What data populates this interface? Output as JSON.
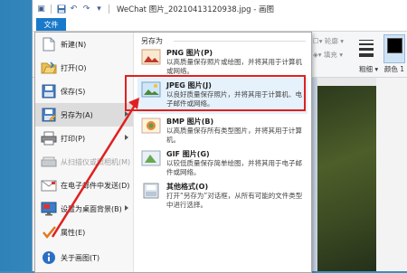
{
  "window": {
    "title": "WeChat 图片_20210413120938.jpg - 画图",
    "file_tab": "文件"
  },
  "ribbon": {
    "outline_label": "轮廓",
    "fill_label": "填充",
    "thickness_label": "粗细",
    "color1_label": "颜色 1"
  },
  "menu": {
    "items": [
      {
        "label": "新建(N)",
        "icon": "new-document-icon"
      },
      {
        "label": "打开(O)",
        "icon": "open-folder-icon"
      },
      {
        "label": "保存(S)",
        "icon": "save-disk-icon"
      },
      {
        "label": "另存为(A)",
        "icon": "save-as-icon"
      },
      {
        "label": "打印(P)",
        "icon": "printer-icon"
      },
      {
        "label": "从扫描仪或照相机(M)",
        "icon": "scanner-icon"
      },
      {
        "label": "在电子邮件中发送(D)",
        "icon": "email-icon"
      },
      {
        "label": "设置为桌面背景(B)",
        "icon": "desktop-background-icon"
      },
      {
        "label": "属性(E)",
        "icon": "properties-check-icon"
      },
      {
        "label": "关于画图(T)",
        "icon": "info-icon"
      }
    ]
  },
  "submenu": {
    "heading": "另存为",
    "items": [
      {
        "title": "PNG 图片(P)",
        "desc": "以高质量保存照片或绘图，并将其用于计算机或网络。",
        "icon": "png-image-icon"
      },
      {
        "title": "JPEG 图片(J)",
        "desc": "以良好质量保存照片，并将其用于计算机、电子邮件或网络。",
        "icon": "jpeg-image-icon"
      },
      {
        "title": "BMP 图片(B)",
        "desc": "以高质量保存所有类型图片，并将其用于计算机。",
        "icon": "bmp-image-icon"
      },
      {
        "title": "GIF 图片(G)",
        "desc": "以较低质量保存简单绘图，并将其用于电子邮件或网络。",
        "icon": "gif-image-icon"
      },
      {
        "title": "其他格式(O)",
        "desc": "打开“另存为”对话框，从所有可能的文件类型中进行选择。",
        "icon": "other-formats-icon"
      }
    ]
  },
  "colors": {
    "file_tab": "#1979ca",
    "highlight": "#e5f1fb",
    "annotation": "#e02020"
  }
}
